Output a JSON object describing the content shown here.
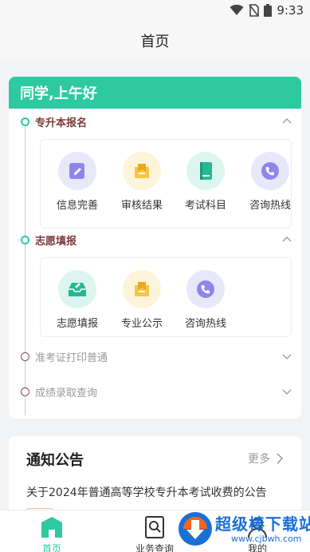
{
  "status_bar": {
    "time": "9:33"
  },
  "header": {
    "title": "首页"
  },
  "greeting": "同学,上午好",
  "sections": [
    {
      "label": "专升本报名",
      "expanded": true,
      "items": [
        {
          "label": "信息完善",
          "icon": "edit-info-icon"
        },
        {
          "label": "审核结果",
          "icon": "review-result-icon"
        },
        {
          "label": "考试科目",
          "icon": "exam-subject-icon"
        },
        {
          "label": "咨询热线",
          "icon": "phone-icon"
        }
      ]
    },
    {
      "label": "志愿填报",
      "expanded": true,
      "items": [
        {
          "label": "志愿填报",
          "icon": "application-inbox-icon"
        },
        {
          "label": "专业公示",
          "icon": "major-notice-icon"
        },
        {
          "label": "咨询热线",
          "icon": "phone-icon"
        }
      ]
    },
    {
      "label": "准考证打印普通",
      "expanded": false
    },
    {
      "label": "成绩录取查询",
      "expanded": false
    }
  ],
  "notice": {
    "title": "通知公告",
    "more": "更多",
    "items": [
      "关于2024年普通高等学校专升本考试收费的公告"
    ]
  },
  "bottom_nav": [
    {
      "label": "首页",
      "active": true
    },
    {
      "label": "业务查询",
      "active": false
    },
    {
      "label": "我的",
      "active": false
    }
  ],
  "watermark": {
    "text": "超级棒下载站",
    "url": "www.cjbwh.com"
  },
  "colors": {
    "accent": "#2ec9a1",
    "section_active": "#7b3a3a",
    "watermark": "#1a6fd6"
  }
}
